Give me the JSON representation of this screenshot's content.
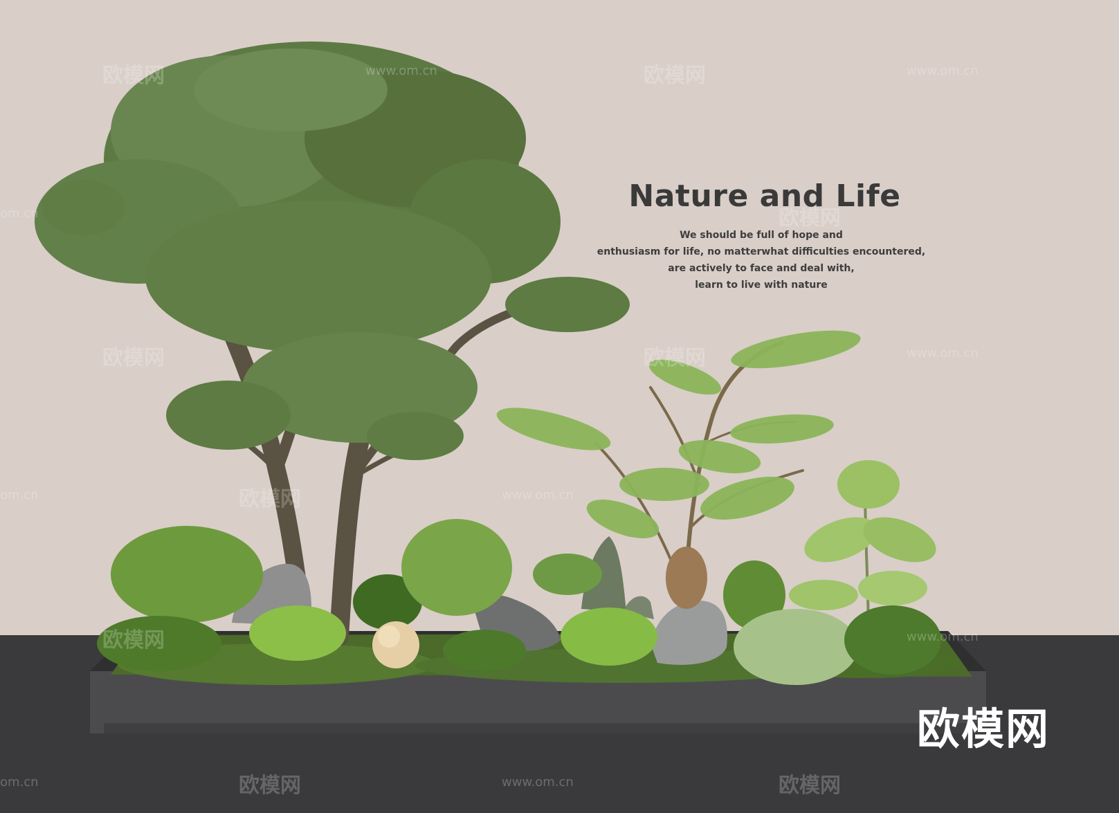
{
  "poster": {
    "title": "Nature and Life",
    "body_lines": [
      "We should be full of hope and",
      "enthusiasm  for life, no matterwhat difficulties encountered,",
      "are actively to face and deal with,",
      "learn to live with nature"
    ]
  },
  "watermarks": {
    "cjk": "欧模网",
    "url": "www.om.cn",
    "url_clip_left": "om.cn"
  },
  "brand_logo": "欧模网",
  "colors": {
    "wall": "#d9cec8",
    "floor": "#3a3a3c",
    "planter": "#4b4b4e",
    "moss": "#4c6a2a",
    "tree_leaf": "#5e7a44",
    "fern": "#8cb55a"
  }
}
